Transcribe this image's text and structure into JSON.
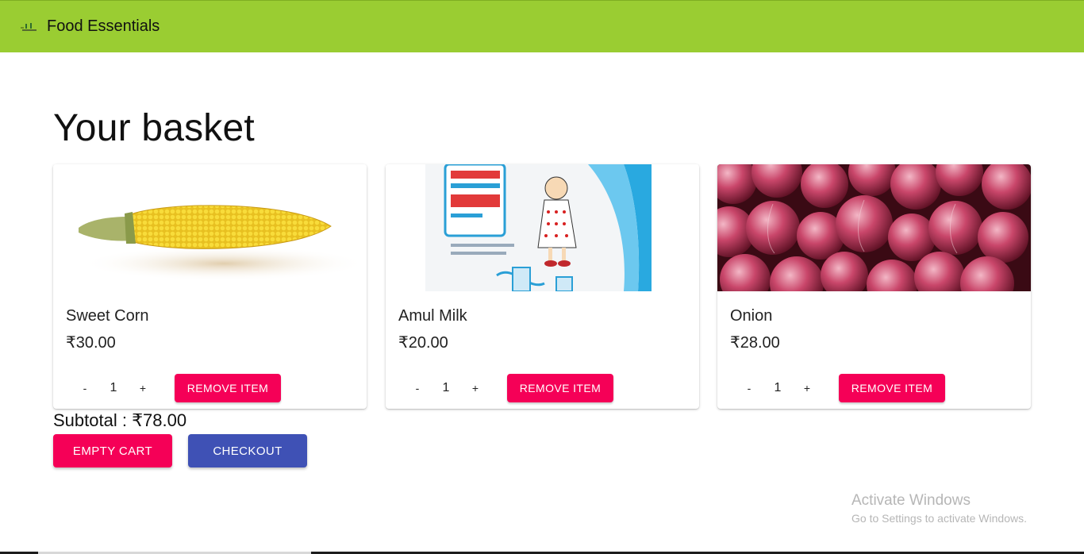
{
  "appbar": {
    "brand": "Food Essentials",
    "logo_icon": "shop-logo-icon",
    "background": "#9acd32"
  },
  "page": {
    "title": "Your basket"
  },
  "items": [
    {
      "name": "Sweet Corn",
      "price": "₹30.00",
      "quantity": "1",
      "minus": "-",
      "plus": "+",
      "remove_label": "REMOVE ITEM",
      "image": "sweet-corn-image"
    },
    {
      "name": "Amul Milk",
      "price": "₹20.00",
      "quantity": "1",
      "minus": "-",
      "plus": "+",
      "remove_label": "REMOVE ITEM",
      "image": "amul-milk-image"
    },
    {
      "name": "Onion",
      "price": "₹28.00",
      "quantity": "1",
      "minus": "-",
      "plus": "+",
      "remove_label": "REMOVE ITEM",
      "image": "onion-image"
    }
  ],
  "cart": {
    "subtotal": "Subtotal : ₹78.00",
    "empty_label": "EMPTY CART",
    "checkout_label": "CHECKOUT"
  },
  "colors": {
    "accent": "#f50057",
    "primary": "#3f51b5"
  },
  "watermark": {
    "line1": "Activate Windows",
    "line2": "Go to Settings to activate Windows."
  }
}
